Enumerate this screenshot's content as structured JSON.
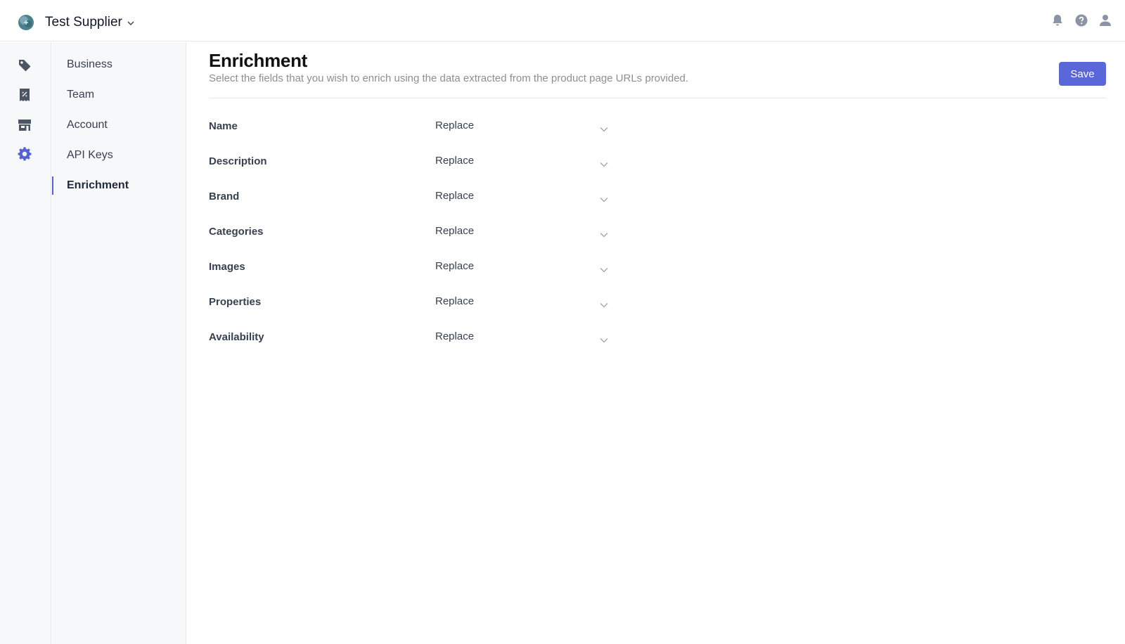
{
  "header": {
    "org_name": "Test Supplier",
    "icons": [
      "logo-icon",
      "chevron-down-icon",
      "bell-icon",
      "help-icon",
      "user-icon"
    ]
  },
  "rail": {
    "items": [
      {
        "icon": "tag-icon"
      },
      {
        "icon": "receipt-icon"
      },
      {
        "icon": "store-icon"
      },
      {
        "icon": "settings-icon",
        "active": true
      }
    ]
  },
  "subnav": {
    "items": [
      {
        "label": "Business"
      },
      {
        "label": "Team"
      },
      {
        "label": "Account"
      },
      {
        "label": "API Keys"
      },
      {
        "label": "Enrichment",
        "active": true
      }
    ]
  },
  "page": {
    "title": "Enrichment",
    "subtitle": "Select the fields that you wish to enrich using the data extracted from the product page URLs provided.",
    "save_label": "Save"
  },
  "fields": [
    {
      "label": "Name",
      "value": "Replace"
    },
    {
      "label": "Description",
      "value": "Replace"
    },
    {
      "label": "Brand",
      "value": "Replace"
    },
    {
      "label": "Categories",
      "value": "Replace"
    },
    {
      "label": "Images",
      "value": "Replace"
    },
    {
      "label": "Properties",
      "value": "Replace"
    },
    {
      "label": "Availability",
      "value": "Replace"
    }
  ],
  "colors": {
    "accent": "#5a67d8",
    "sidebar_bg": "#f7f8fa",
    "icon_gray": "#4b5563",
    "active_icon": "#5563d6"
  }
}
